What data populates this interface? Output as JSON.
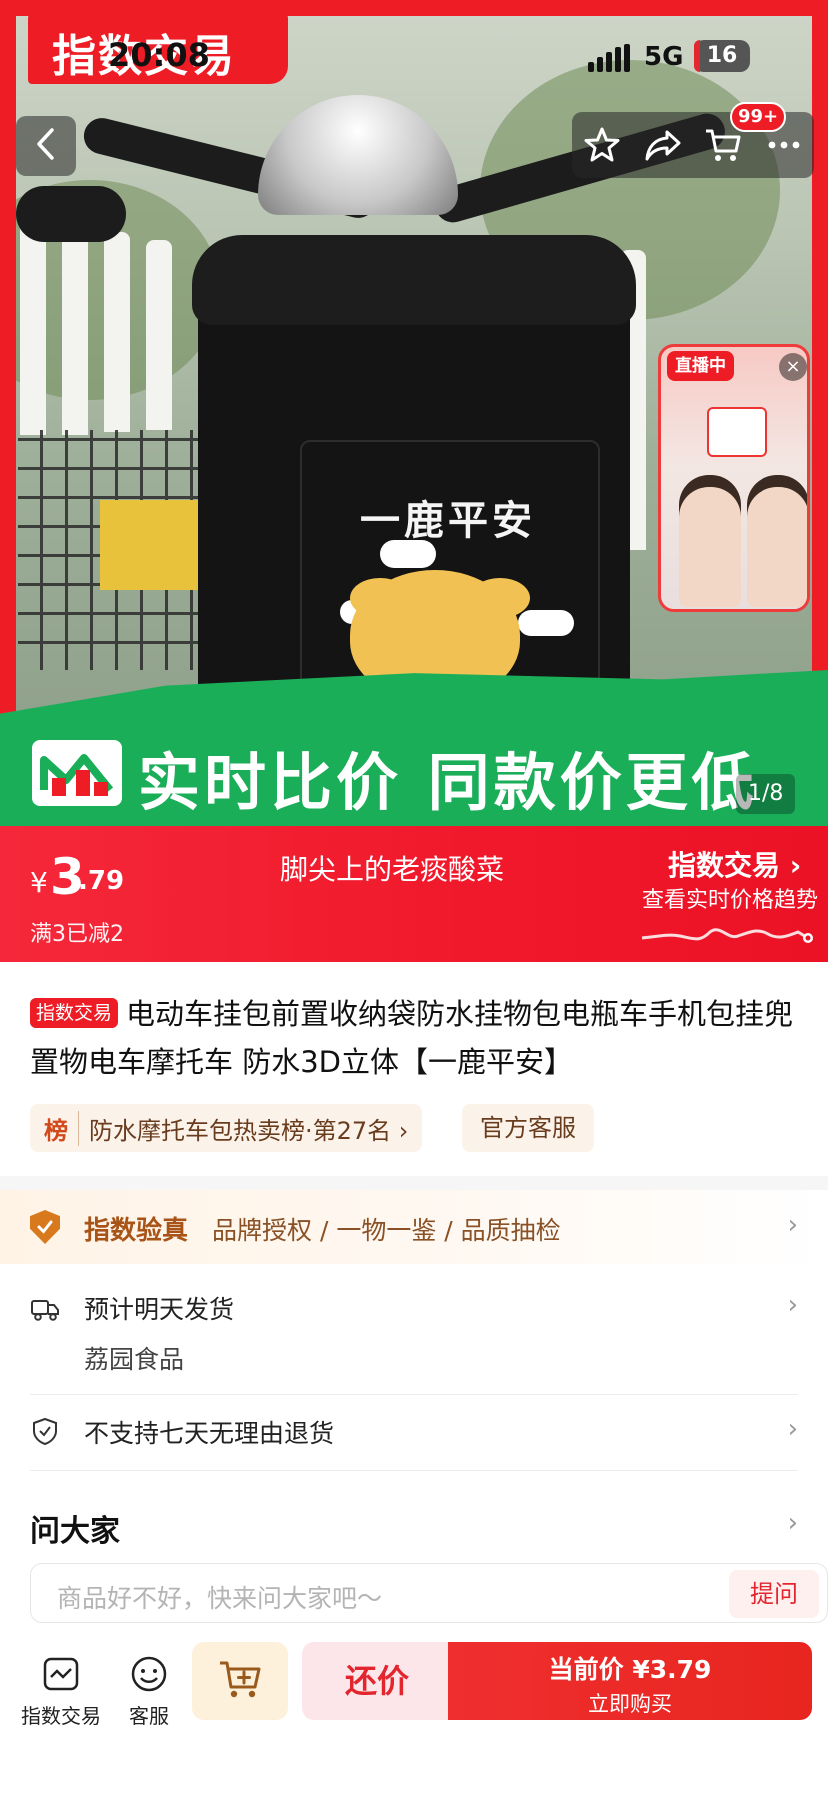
{
  "status_bar": {
    "time": "20:08",
    "network": "5G",
    "battery": "16"
  },
  "hero": {
    "brand_tag": "指数交易",
    "bag_print": "一鹿平安",
    "banner_text": "实时比价 同款价更低",
    "image_counter": "1/8",
    "cart_badge": "99+",
    "live_badge": "直播中",
    "live_close": "×"
  },
  "icons": {
    "back": "chevron-left-icon",
    "favorite": "star-icon",
    "share": "share-icon",
    "cart": "cart-icon",
    "more": "more-icon"
  },
  "price_bar": {
    "currency": "¥",
    "price_int": "3",
    "price_dec": ".79",
    "shop_name": "脚尖上的老痰酸菜",
    "promo": "满3已减2",
    "brand_link": "指数交易 ›",
    "trend_link": "查看实时价格趋势"
  },
  "product": {
    "title_tag": "指数交易",
    "title": "电动车挂包前置收纳袋防水挂物包电瓶车手机包挂兜置物电车摩托车 防水3D立体【一鹿平安】",
    "rank_tag": "榜",
    "rank_text": "防水摩托车包热卖榜·第27名 ›",
    "service": "官方客服"
  },
  "verify": {
    "title": "指数验真",
    "items": "品牌授权 / 一物一鉴 / 品质抽检"
  },
  "delivery": {
    "text": "预计明天发货",
    "sub": "荔园食品"
  },
  "returns": {
    "text": "不支持七天无理由退货"
  },
  "ask": {
    "title": "问大家",
    "placeholder": "商品好不好，快来问大家吧～",
    "button": "提问"
  },
  "chevron": "›",
  "bottom_bar": {
    "tab_store": "指数交易",
    "tab_service": "客服",
    "bargain": "还价",
    "buy_price": "当前价 ¥3.79",
    "buy_sub": "立即购买"
  },
  "colors": {
    "brand_red": "#ee1c25",
    "banner_green": "#1aae59",
    "verify_orange": "#d8791e"
  }
}
